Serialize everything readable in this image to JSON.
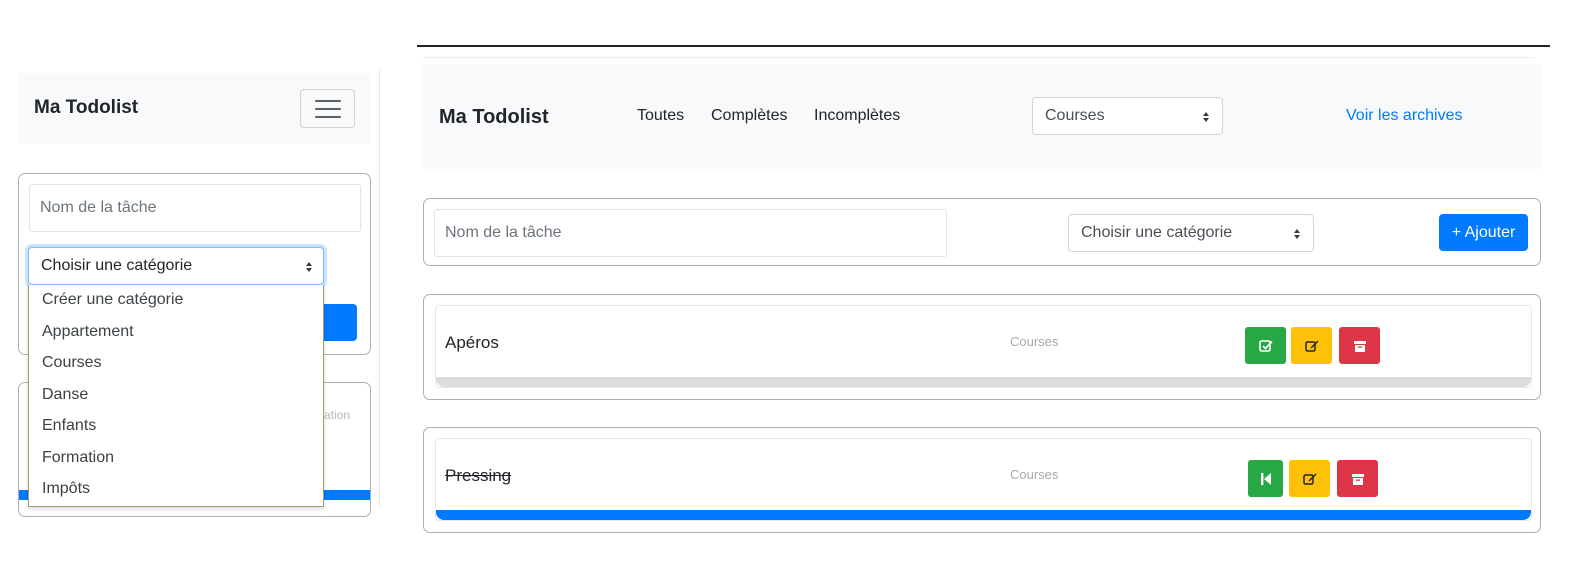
{
  "mobile": {
    "brand": "Ma Todolist",
    "task_placeholder": "Nom de la tâche",
    "category_select": "Choisir une catégorie",
    "dropdown_options": [
      "Créer une catégorie",
      "Appartement",
      "Courses",
      "Danse",
      "Enfants",
      "Formation",
      "Impôts"
    ],
    "card2_category_fragment": "ation"
  },
  "desktop": {
    "brand": "Ma Todolist",
    "nav": {
      "toutes": "Toutes",
      "completes": "Complètes",
      "incompletes": "Incomplètes"
    },
    "category_filter": "Courses",
    "archives_link": "Voir les archives",
    "form": {
      "task_placeholder": "Nom de la tâche",
      "category_select": "Choisir une catégorie",
      "add_button": "+ Ajouter"
    },
    "tasks": [
      {
        "title": "Apéros",
        "category": "Courses",
        "completed": false
      },
      {
        "title": "Pressing",
        "category": "Courses",
        "completed": true
      }
    ]
  },
  "colors": {
    "primary": "#007bff",
    "success": "#28a745",
    "warning": "#ffc107",
    "danger": "#dc3545",
    "navbar_bg": "#f8f9fa"
  },
  "icons": {
    "toggler": "hamburger-icon",
    "complete": "check-square-icon",
    "edit": "edit-icon",
    "archive": "archive-icon",
    "undo": "step-backward-icon"
  }
}
